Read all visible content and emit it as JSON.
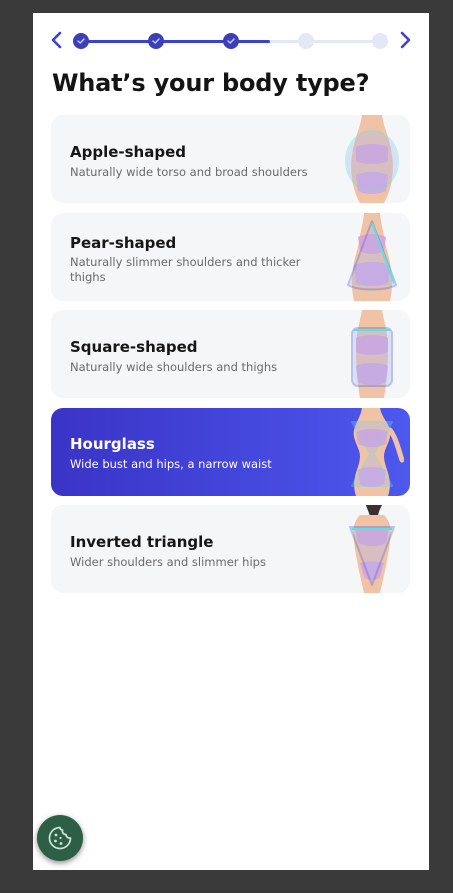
{
  "page": {
    "title": "What’s your body type?"
  },
  "stepper": {
    "total_steps": 5,
    "completed_steps": 3,
    "progress_fraction": 0.63,
    "colors": {
      "done": "#3b3fb8",
      "pending": "#e3e7f6",
      "accent": "#3b41d0"
    }
  },
  "options": [
    {
      "label": "Apple-shaped",
      "description": "Naturally wide torso and broad shoulders",
      "selected": false
    },
    {
      "label": "Pear-shaped",
      "description": "Naturally slimmer shoulders and thicker thighs",
      "selected": false
    },
    {
      "label": "Square-shaped",
      "description": "Naturally wide shoulders and thighs",
      "selected": false
    },
    {
      "label": "Hourglass",
      "description": "Wide bust and hips, a narrow waist",
      "selected": true
    },
    {
      "label": "Inverted triangle",
      "description": "Wider shoulders and slimmer hips",
      "selected": false
    }
  ],
  "icons": {
    "back": "chevron-left-icon",
    "next": "chevron-right-icon",
    "cookie": "cookie-icon"
  }
}
